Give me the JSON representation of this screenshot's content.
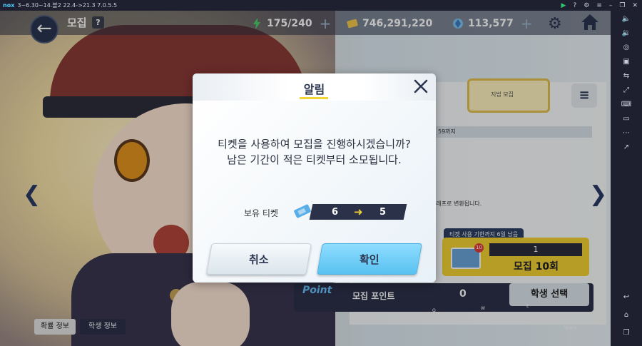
{
  "emulator": {
    "logo": "nox",
    "version_text": "3~6.30~14.블2 22.4->21.3 7.0.5.5"
  },
  "topbar": {
    "title": "모집",
    "help_label": "?",
    "ap_value": "175/240",
    "credits_value": "746,291,220",
    "gems_value": "113,577"
  },
  "dialog": {
    "title": "알림",
    "message_line1": "티켓을 사용하여 모집을 진행하시겠습니까?",
    "message_line2": "남은 기간이 적은 티켓부터 소모됩니다.",
    "ticket_label": "보유 티켓",
    "ticket_from": "6",
    "ticket_to": "5",
    "cancel_label": "취소",
    "confirm_label": "확인"
  },
  "background": {
    "banner_label": "지법 모집",
    "date_fragment": "59까지",
    "convert_fragment": "엘레프로 변환됩니다.",
    "ticket_limit_badge": "티켓 사용 기한까지 6일 남음",
    "mail_badge": "10",
    "recruit10_count": "1",
    "recruit10_label": "모집 10회",
    "point_icon_label": "Point",
    "point_label": "모집 포인트",
    "point_value": "0",
    "student_select_label": "학생 선택",
    "prob_info_label": "확률 정보",
    "student_info_label": "학생 정보",
    "key_hints": [
      "Q",
      "W",
      "E",
      "Space"
    ]
  },
  "colors": {
    "accent_yellow": "#f0d634",
    "navy": "#2a3550",
    "confirm_blue": "#58c2f0"
  }
}
